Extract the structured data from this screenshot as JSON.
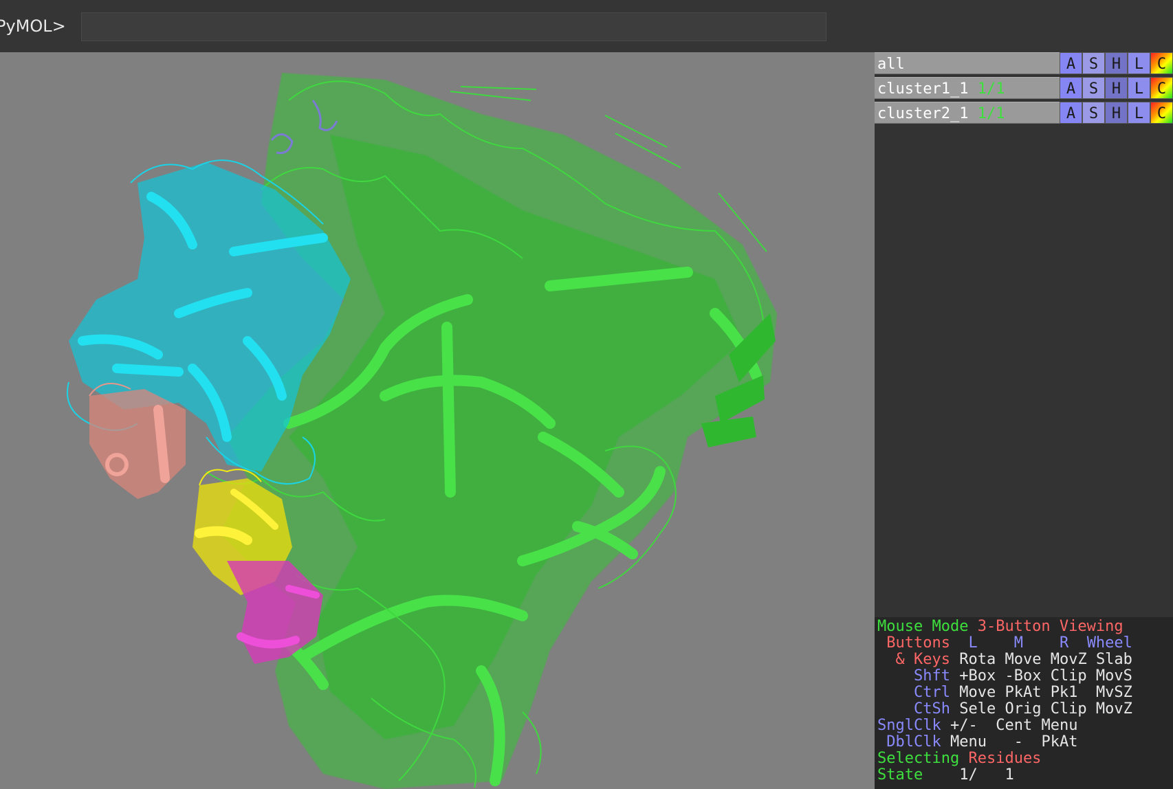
{
  "command_line": {
    "prompt": "PyMOL>",
    "value": ""
  },
  "colors": {
    "viewport_bg": "#808080",
    "chain_green": "#3fd83f",
    "chain_cyan": "#19d4e6",
    "chain_salmon": "#e8958a",
    "chain_yellow": "#f2ea14",
    "chain_magenta": "#e03fc8",
    "chain_slate": "#7b7bd6"
  },
  "objects": [
    {
      "name": "all",
      "state": "",
      "buttons": [
        "A",
        "S",
        "H",
        "L",
        "C"
      ]
    },
    {
      "name": "cluster1_1",
      "state": "1/1",
      "buttons": [
        "A",
        "S",
        "H",
        "L",
        "C"
      ]
    },
    {
      "name": "cluster2_1",
      "state": "1/1",
      "buttons": [
        "A",
        "S",
        "H",
        "L",
        "C"
      ]
    }
  ],
  "mouse_legend": {
    "mode_label": "Mouse Mode",
    "mode_value": "3-Button Viewing",
    "buttons_label": "Buttons",
    "col_l": "L",
    "col_m": "M",
    "col_r": "R",
    "col_wheel": "Wheel",
    "keys_label": "& Keys",
    "rows": [
      {
        "key": "",
        "l": "Rota",
        "m": "Move",
        "r": "MovZ",
        "w": "Slab"
      },
      {
        "key": "Shft",
        "l": "+Box",
        "m": "-Box",
        "r": "Clip",
        "w": "MovS"
      },
      {
        "key": "Ctrl",
        "l": "Move",
        "m": "PkAt",
        "r": "Pk1",
        "w": "MvSZ"
      },
      {
        "key": "CtSh",
        "l": "Sele",
        "m": "Orig",
        "r": "Clip",
        "w": "MovZ"
      },
      {
        "key": "SnglClk",
        "l": "+/-",
        "m": "Cent",
        "r": "Menu",
        "w": ""
      },
      {
        "key": "DblClk",
        "l": "Menu",
        "m": "-",
        "r": "PkAt",
        "w": ""
      }
    ],
    "selecting_label": "Selecting",
    "selecting_value": "Residues",
    "state_label": "State",
    "state_value": "1/",
    "state_total": "1"
  }
}
